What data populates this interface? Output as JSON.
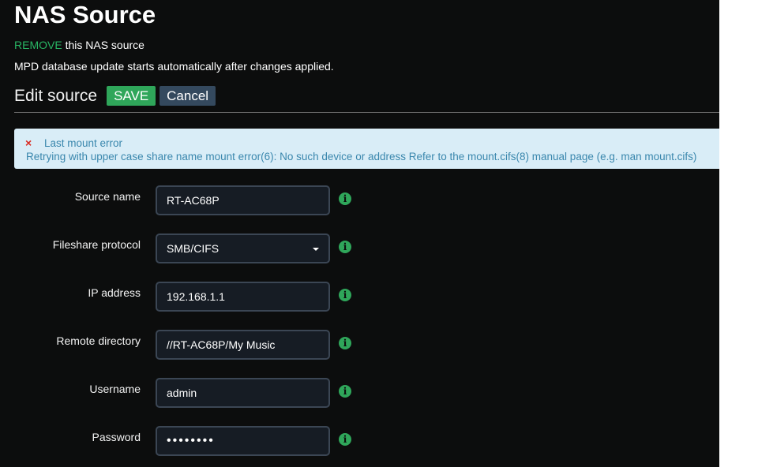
{
  "header": {
    "title": "NAS Source",
    "remove_link": "REMOVE",
    "remove_suffix": " this NAS source",
    "info": "MPD database update starts automatically after changes applied."
  },
  "edit": {
    "title": "Edit source",
    "save_label": "SAVE",
    "cancel_label": "Cancel"
  },
  "alert": {
    "icon": "×",
    "title": "Last mount error",
    "message": "Retrying with upper case share name mount error(6): No such device or address Refer to the mount.cifs(8) manual page (e.g. man mount.cifs)"
  },
  "form": {
    "source_name": {
      "label": "Source name",
      "value": "RT-AC68P"
    },
    "protocol": {
      "label": "Fileshare protocol",
      "value": "SMB/CIFS"
    },
    "ip": {
      "label": "IP address",
      "value": "192.168.1.1"
    },
    "remote_dir": {
      "label": "Remote directory",
      "value": "//RT-AC68P/My Music"
    },
    "username": {
      "label": "Username",
      "value": "admin"
    },
    "password": {
      "label": "Password",
      "value": "••••••••"
    },
    "info_glyph": "i"
  },
  "colors": {
    "accent_green": "#2fa65a",
    "alert_bg": "#d9edf7",
    "alert_text": "#3a87ad",
    "error_red": "#d9281e",
    "panel_bg": "#0c0d0d"
  }
}
